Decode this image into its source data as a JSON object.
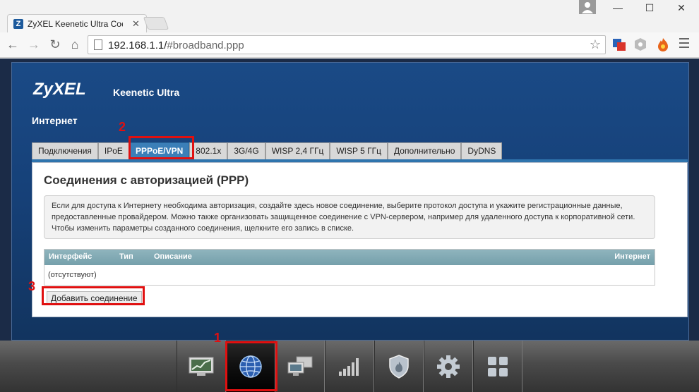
{
  "browser": {
    "tab_title": "ZyXEL Keenetic Ultra Соед",
    "tab_favicon": "Z",
    "url_host": "192.168.1.1/",
    "url_path": "#broadband.ppp"
  },
  "router": {
    "logo": "ZyXEL",
    "model": "Keenetic Ultra",
    "section": "Интернет",
    "tabs": [
      {
        "label": "Подключения"
      },
      {
        "label": "IPoE"
      },
      {
        "label": "PPPoE/VPN"
      },
      {
        "label": "802.1x"
      },
      {
        "label": "3G/4G"
      },
      {
        "label": "WISP 2,4 ГГц"
      },
      {
        "label": "WISP 5 ГГц"
      },
      {
        "label": "Дополнительно"
      },
      {
        "label": "DyDNS"
      }
    ],
    "active_tab": "PPPoE/VPN",
    "panel": {
      "title": "Соединения с авторизацией (PPP)",
      "info": "Если для доступа к Интернету необходима авторизация, создайте здесь новое соединение, выберите протокол доступа и укажите регистрационные данные, предоставленные провайдером. Можно также организовать защищенное соединение с VPN-сервером, например для удаленного доступа к корпоративной сети. Чтобы изменить параметры созданного соединения, щелкните его запись в списке.",
      "columns": [
        "Интерфейс",
        "Тип",
        "Описание",
        "Интернет"
      ],
      "empty_text": "(отсутствуют)",
      "add_button": "Добавить соединение"
    },
    "dock": [
      {
        "icon": "monitor-chart-icon"
      },
      {
        "icon": "globe-icon",
        "active": true
      },
      {
        "icon": "network-computers-icon"
      },
      {
        "icon": "wifi-signal-bars-icon"
      },
      {
        "icon": "shield-icon"
      },
      {
        "icon": "gear-icon"
      },
      {
        "icon": "apps-grid-icon"
      }
    ]
  },
  "annotations": [
    "1",
    "2",
    "3"
  ],
  "colors": {
    "accent": "#3b7fb8",
    "annotation": "#e01010",
    "router_bg": "#164179"
  }
}
